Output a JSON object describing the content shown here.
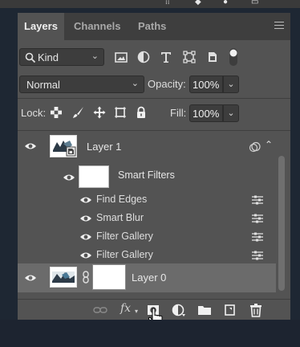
{
  "panel": {
    "tabs": [
      {
        "label": "Layers",
        "active": true
      },
      {
        "label": "Channels",
        "active": false
      },
      {
        "label": "Paths",
        "active": false
      }
    ]
  },
  "filter": {
    "kind_label": "Kind",
    "icons": [
      "pixel-filter-icon",
      "adjustment-filter-icon",
      "type-filter-icon",
      "shape-filter-icon",
      "smart-object-filter-icon",
      "filter-toggle-icon"
    ]
  },
  "blend": {
    "mode": "Normal",
    "opacity_label": "Opacity:",
    "opacity_value": "100%"
  },
  "lock": {
    "label": "Lock:",
    "fill_label": "Fill:",
    "fill_value": "100%"
  },
  "layers": {
    "layer1": {
      "name": "Layer 1"
    },
    "smart_filters": {
      "label": "Smart Filters"
    },
    "filters": [
      {
        "name": "Find Edges"
      },
      {
        "name": "Smart Blur"
      },
      {
        "name": "Filter Gallery"
      },
      {
        "name": "Filter Gallery"
      }
    ],
    "layer0": {
      "name": "Layer 0"
    }
  },
  "bottom": {
    "icons": [
      "link-layers-icon",
      "fx-icon",
      "add-mask-icon",
      "adjustment-layer-icon",
      "new-group-icon",
      "new-layer-icon",
      "delete-icon"
    ],
    "fx_label": "fx"
  },
  "colors": {
    "panel": "#535353",
    "tab_bar": "#3e3e3e",
    "selected_layer": "#6b6b6b",
    "desktop": "#1d2430"
  }
}
